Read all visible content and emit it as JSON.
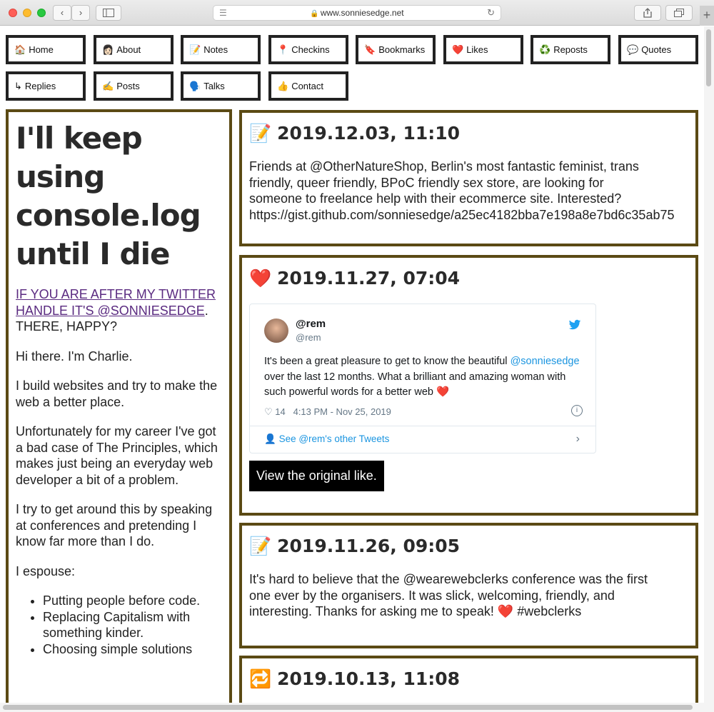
{
  "browser": {
    "url": "www.sonniesedge.net",
    "back_label": "‹",
    "forward_label": "›",
    "newtab_label": "+"
  },
  "nav": [
    {
      "icon": "🏠",
      "icon_name": "house-icon",
      "label": "Home"
    },
    {
      "icon": "👩🏻",
      "icon_name": "person-icon",
      "label": "About"
    },
    {
      "icon": "📝",
      "icon_name": "memo-icon",
      "label": "Notes"
    },
    {
      "icon": "📍",
      "icon_name": "pin-icon",
      "label": "Checkins"
    },
    {
      "icon": "🔖",
      "icon_name": "bookmark-icon",
      "label": "Bookmarks"
    },
    {
      "icon": "❤️",
      "icon_name": "heart-icon",
      "label": "Likes"
    },
    {
      "icon": "♻️",
      "icon_name": "recycle-icon",
      "label": "Reposts"
    },
    {
      "icon": "💬",
      "icon_name": "speech-bubble-icon",
      "label": "Quotes"
    },
    {
      "icon": "↳",
      "icon_name": "reply-arrow-icon",
      "label": "Replies"
    },
    {
      "icon": "✍️",
      "icon_name": "writing-hand-icon",
      "label": "Posts"
    },
    {
      "icon": "🗣️",
      "icon_name": "speaking-head-icon",
      "label": "Talks"
    },
    {
      "icon": "👍",
      "icon_name": "thumbs-up-icon",
      "label": "Contact"
    }
  ],
  "sidebar": {
    "title": "I'll keep using console.log until I die",
    "twitter_link": "IF YOU ARE AFTER MY TWITTER HANDLE IT'S @SONNIESEDGE",
    "twitter_rest": ". THERE, HAPPY?",
    "para1": "Hi there. I'm Charlie.",
    "para2": "I build websites and try to make the web a better place.",
    "para3": "Unfortunately for my career I've got a bad case of The Principles, which makes just being an everyday web developer a bit of a problem.",
    "para4": "I try to get around this by speaking at conferences and pretending I know far more than I do.",
    "para5": "I espouse:",
    "list": [
      "Putting people before code.",
      "Replacing Capitalism with something kinder.",
      "Choosing simple solutions"
    ]
  },
  "posts": [
    {
      "emoji": "📝",
      "icon_name": "memo-icon",
      "title": "2019.12.03, 11:10",
      "lines": [
        "Friends at @OtherNatureShop, Berlin's most fantastic feminist, trans",
        "friendly, queer friendly, BPoC friendly sex store, are looking for",
        "someone to freelance help with their ecommerce site. Interested?",
        "https://gist.github.com/sonniesedge/a25ec4182bba7e198a8e7bd6c35ab75"
      ]
    },
    {
      "emoji": "❤️",
      "icon_name": "heart-icon",
      "title": "2019.11.27, 07:04",
      "tweet": {
        "name": "@rem",
        "handle": "@rem",
        "text_before": "It's been a great pleasure to get to know the beautiful ",
        "mention": "@sonniesedge",
        "text_after": " over the last 12 months. What a brilliant and amazing woman with such powerful words for a better web ❤️",
        "likes": "14",
        "timestamp": "4:13 PM - Nov 25, 2019",
        "footer": "See @rem's other Tweets"
      },
      "button": "View the original like."
    },
    {
      "emoji": "📝",
      "icon_name": "memo-icon",
      "title": "2019.11.26, 09:05",
      "lines": [
        "It's hard to believe that the @wearewebclerks conference was the first",
        "one ever by the organisers. It was slick, welcoming, friendly, and",
        "interesting. Thanks for asking me to speak! ❤️ #webclerks"
      ]
    },
    {
      "emoji": "🔁",
      "icon_name": "repost-icon",
      "title": "2019.10.13, 11:08"
    }
  ],
  "colors": {
    "post_border": "#5b4a14",
    "nav_border": "#222222",
    "link": "#5a2a80",
    "twitter_blue": "#1b95e0"
  }
}
